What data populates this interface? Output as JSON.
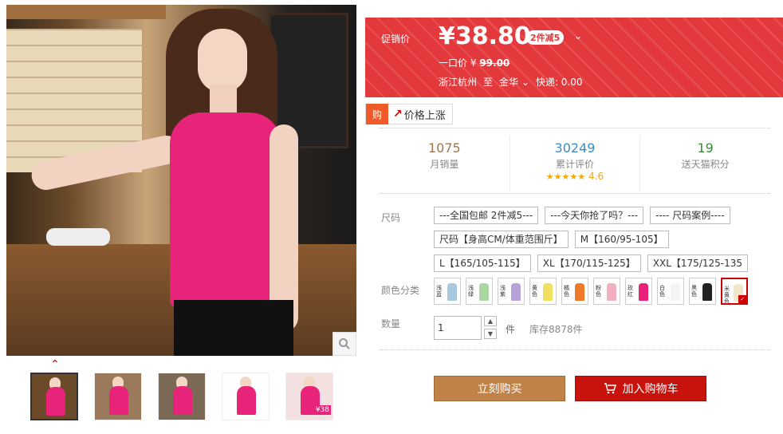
{
  "gallery": {
    "zoom_icon": "search-icon",
    "thumbnails": [
      {
        "bg": "#6b4a2a",
        "badge": ""
      },
      {
        "bg": "#9a7a5a",
        "badge": ""
      },
      {
        "bg": "#7a6a55",
        "badge": ""
      },
      {
        "bg": "#ffffff",
        "badge": ""
      },
      {
        "bg": "#f3e0e0",
        "badge": "¥38"
      }
    ]
  },
  "promo": {
    "label": "促销价",
    "price": "¥38.80",
    "discount_badge": "2件减5",
    "original_label": "一口价",
    "original_currency": "¥",
    "original_price": "99.00",
    "ship_from": "浙江杭州",
    "ship_to_word": "至",
    "ship_dest": "金华",
    "shipping": "快递: 0.00"
  },
  "price_rise": {
    "icon_text": "购",
    "label": "价格上涨"
  },
  "stats": [
    {
      "value": "1075",
      "label": "月销量",
      "color": "#a0764a"
    },
    {
      "value": "30249",
      "label": "累计评价",
      "color": "#3a8cc8",
      "stars": "★★★★★",
      "rating": "4.6"
    },
    {
      "value": "19",
      "label": "送天猫积分",
      "color": "#3a8a3a"
    }
  ],
  "size_label": "尺码",
  "sizes": [
    "---全国包邮 2件减5---",
    "---今天你抢了吗？---",
    "---- 尺码案例----",
    "尺码【身高CM/体重范围斤】",
    "M【160/95-105】",
    "L【165/105-115】",
    "XL【170/115-125】",
    "XXL【175/125-135"
  ],
  "color_label": "颜色分类",
  "colors": [
    {
      "text": "浅蓝",
      "fig": "#a8c8e0"
    },
    {
      "text": "浅绿",
      "fig": "#a8d8a0"
    },
    {
      "text": "浅紫",
      "fig": "#b8a0d8"
    },
    {
      "text": "黄色",
      "fig": "#f0e060"
    },
    {
      "text": "橘色",
      "fig": "#f07a2a"
    },
    {
      "text": "粉色",
      "fig": "#f0b0c0"
    },
    {
      "text": "玫红",
      "fig": "#e8237a"
    },
    {
      "text": "白色",
      "fig": "#f4f4f4"
    },
    {
      "text": "黑色",
      "fig": "#222222"
    },
    {
      "text": "米黄色",
      "fig": "#f0e6cc"
    }
  ],
  "selected_color_index": 9,
  "qty_label": "数量",
  "qty_value": "1",
  "qty_unit": "件",
  "stock": "库存8878件",
  "buy_now": "立刻购买",
  "add_cart": "加入购物车"
}
